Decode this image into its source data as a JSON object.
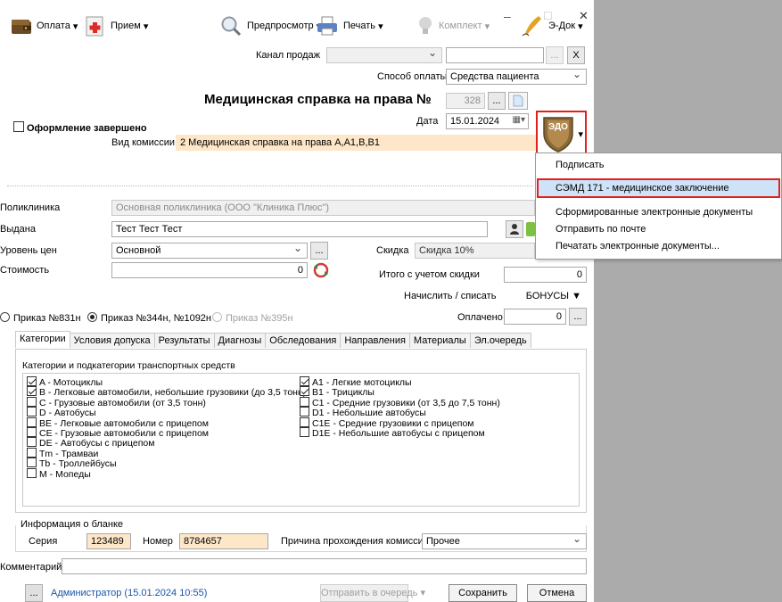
{
  "window": {
    "minimize_glyph": "–",
    "maximize_glyph": "□",
    "close_glyph": "✕"
  },
  "toolbar": {
    "payment": "Оплата",
    "reception": "Прием",
    "preview": "Предпросмотр",
    "print": "Печать",
    "kit": "Комплект",
    "edoc": "Э-Док",
    "arrow": "▾"
  },
  "form": {
    "sales_channel_label": "Канал продаж",
    "payment_method_label": "Способ оплаты",
    "payment_method_value": "Средства пациента",
    "ellipsis": "...",
    "clear": "X",
    "title": "Медицинская справка на права №",
    "number": "328",
    "date_label": "Дата",
    "date_value": "15.01.2024",
    "completed_label": "Оформление завершено",
    "commission_label": "Вид комиссии",
    "commission_value": "2 Медицинская справка на права А,А1,В,В1",
    "clinic_label": "Поликлиника",
    "clinic_value": "Основная поликлиника (ООО \"Клиника Плюс\")",
    "issued_label": "Выдана",
    "issued_value": "Тест Тест Тест",
    "price_level_label": "Уровень цен",
    "price_level_value": "Основной",
    "discount_label": "Скидка",
    "discount_value": "Скидка 10%",
    "cost_label": "Стоимость",
    "cost_value": "0",
    "total_label": "Итого с учетом скидки",
    "total_value": "0",
    "accrue_label": "Начислить / списать",
    "bonus_label": "БОНУСЫ",
    "paid_label": "Оплачено",
    "paid_value": "0",
    "order_831": "Приказ №831н",
    "order_344": "Приказ №344н, №1092н",
    "order_395": "Приказ №395н"
  },
  "tabs": [
    "Категории",
    "Условия допуска",
    "Результаты",
    "Диагнозы",
    "Обследования",
    "Направления",
    "Материалы",
    "Эл.очередь"
  ],
  "categories": {
    "header": "Категории и подкатегории транспортных средств",
    "left": [
      {
        "label": "A - Мотоциклы",
        "checked": true
      },
      {
        "label": "B - Легковые автомобили, небольшие грузовики (до 3,5 тонн)",
        "checked": true
      },
      {
        "label": "C - Грузовые автомобили (от 3,5 тонн)",
        "checked": false
      },
      {
        "label": "D - Автобусы",
        "checked": false
      },
      {
        "label": "BE - Легковые автомобили с прицепом",
        "checked": false
      },
      {
        "label": "CE - Грузовые автомобили с прицепом",
        "checked": false
      },
      {
        "label": "DE - Автобусы с прицепом",
        "checked": false
      },
      {
        "label": "Tm - Трамваи",
        "checked": false
      },
      {
        "label": "Tb - Троллейбусы",
        "checked": false
      },
      {
        "label": "M - Мопеды",
        "checked": false
      }
    ],
    "right": [
      {
        "label": "A1 - Легкие мотоциклы",
        "checked": true
      },
      {
        "label": "B1 - Трициклы",
        "checked": true
      },
      {
        "label": "C1 - Средние грузовики (от 3,5 до 7,5 тонн)",
        "checked": false
      },
      {
        "label": "D1 - Небольшие автобусы",
        "checked": false
      },
      {
        "label": "C1E - Средние грузовики с прицепом",
        "checked": false
      },
      {
        "label": "D1E - Небольшие автобусы с прицепом",
        "checked": false
      }
    ]
  },
  "blank": {
    "legend": "Информация о бланке",
    "series_label": "Серия",
    "series_value": "123489",
    "number_label": "Номер",
    "number_value": "8784657",
    "reason_label": "Причина прохождения комиссии",
    "reason_value": "Прочее"
  },
  "comment_label": "Комментарий",
  "footer": {
    "ellipsis": "...",
    "user": "Администратор (15.01.2024 10:55)",
    "queue": "Отправить в очередь",
    "save": "Сохранить",
    "cancel": "Отмена"
  },
  "edoc_badge": "ЭДО",
  "menu": {
    "items": [
      "Подписать",
      "СЭМД 171 - медицинское заключение",
      "Сформированные электронные документы",
      "Отправить по почте",
      "Печатать электронные документы..."
    ]
  },
  "colors": {
    "highlight": "#e02020",
    "link": "#1a55a8",
    "selection": "#cfe3f8"
  }
}
